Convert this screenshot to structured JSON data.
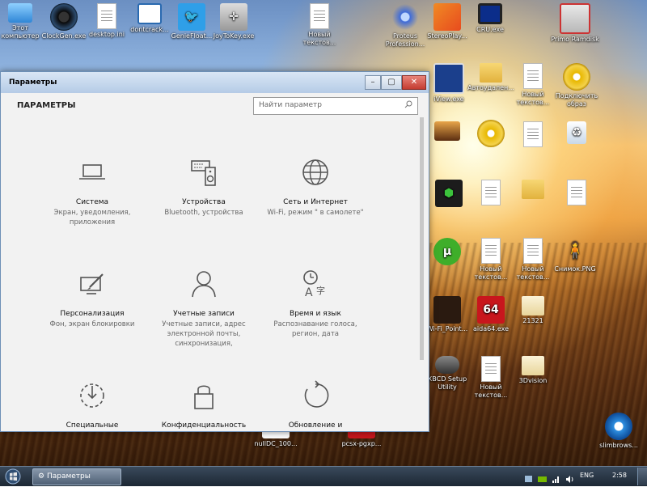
{
  "desktop_icons": [
    {
      "label": "Этот компьютер",
      "icon": "computer-icon"
    },
    {
      "label": "ClockGen.exe",
      "icon": "gauge-icon"
    },
    {
      "label": "desktop.ini",
      "icon": "gear-file-icon"
    },
    {
      "label": "dontcrack...",
      "icon": "window-icon"
    },
    {
      "label": "GenieFloat...",
      "icon": "bird-icon"
    },
    {
      "label": "JoyToKey.exe",
      "icon": "joystick-icon"
    },
    {
      "label": "Новый текстов...",
      "icon": "document-icon"
    },
    {
      "label": "Proteus Profession...",
      "icon": "proteus-icon"
    },
    {
      "label": "StereoPlay...",
      "icon": "cubes-icon"
    },
    {
      "label": "CRU.exe",
      "icon": "monitor-icon"
    },
    {
      "label": "Primo Ramdisk",
      "icon": "ramdisk-icon"
    },
    {
      "label": "iView.exe",
      "icon": "iview-icon"
    },
    {
      "label": "Автоудален...",
      "icon": "folder-icon"
    },
    {
      "label": "Новый текстов...",
      "icon": "document-icon"
    },
    {
      "label": "Подключить образ",
      "icon": "disc-icon"
    },
    {
      "label": "nullDC_100...",
      "icon": "nulldc-icon"
    },
    {
      "label": "pcsx-pgxp...",
      "icon": "pcsx-icon"
    },
    {
      "label": "Новый текстов...",
      "icon": "document-icon"
    },
    {
      "label": "Новый текстов...",
      "icon": "document-icon"
    },
    {
      "label": "Снимок.PNG",
      "icon": "image-icon"
    },
    {
      "label": "Wi-Fi_Point...",
      "icon": "wifi-icon"
    },
    {
      "label": "aida64.exe",
      "icon": "aida64-icon"
    },
    {
      "label": "21321",
      "icon": "folder-icon"
    },
    {
      "label": "XBCD Setup Utility",
      "icon": "gamepad-icon"
    },
    {
      "label": "Новый текстов...",
      "icon": "document-icon"
    },
    {
      "label": "3Dvision",
      "icon": "folder-icon"
    },
    {
      "label": "slimbrows...",
      "icon": "browser-icon"
    }
  ],
  "aida_label": "64",
  "window": {
    "title": "Параметры",
    "header": "ПАРАМЕТРЫ",
    "search_placeholder": "Найти параметр",
    "tiles": [
      {
        "name": "Система",
        "desc": "Экран, уведомления, приложения",
        "icon": "laptop-icon"
      },
      {
        "name": "Устройства",
        "desc": "Bluetooth, устройства",
        "icon": "keyboard-speaker-icon"
      },
      {
        "name": "Сеть и Интернет",
        "desc": "Wi-Fi, режим \" в самолете\"",
        "icon": "globe-icon"
      },
      {
        "name": "Персонализация",
        "desc": "Фон, экран блокировки",
        "icon": "paint-brush-icon"
      },
      {
        "name": "Учетные записи",
        "desc": "Учетные записи, адрес электронной почты, синхронизация,",
        "icon": "person-icon"
      },
      {
        "name": "Время и язык",
        "desc": "Распознавание голоса, регион, дата",
        "icon": "time-language-icon"
      },
      {
        "name": "Специальные",
        "desc": "",
        "icon": "accessibility-icon"
      },
      {
        "name": "Конфиденциальность",
        "desc": "",
        "icon": "lock-icon"
      },
      {
        "name": "Обновление и",
        "desc": "",
        "icon": "update-icon"
      }
    ]
  },
  "taskbar": {
    "active_window_label": "Параметры",
    "language": "ENG",
    "clock": "2:58"
  },
  "colors": {
    "window_bg": "#f2f2f2",
    "titlebar": "#b5cbe6",
    "icon_stroke": "#555555",
    "taskbar": "#1c2733"
  }
}
